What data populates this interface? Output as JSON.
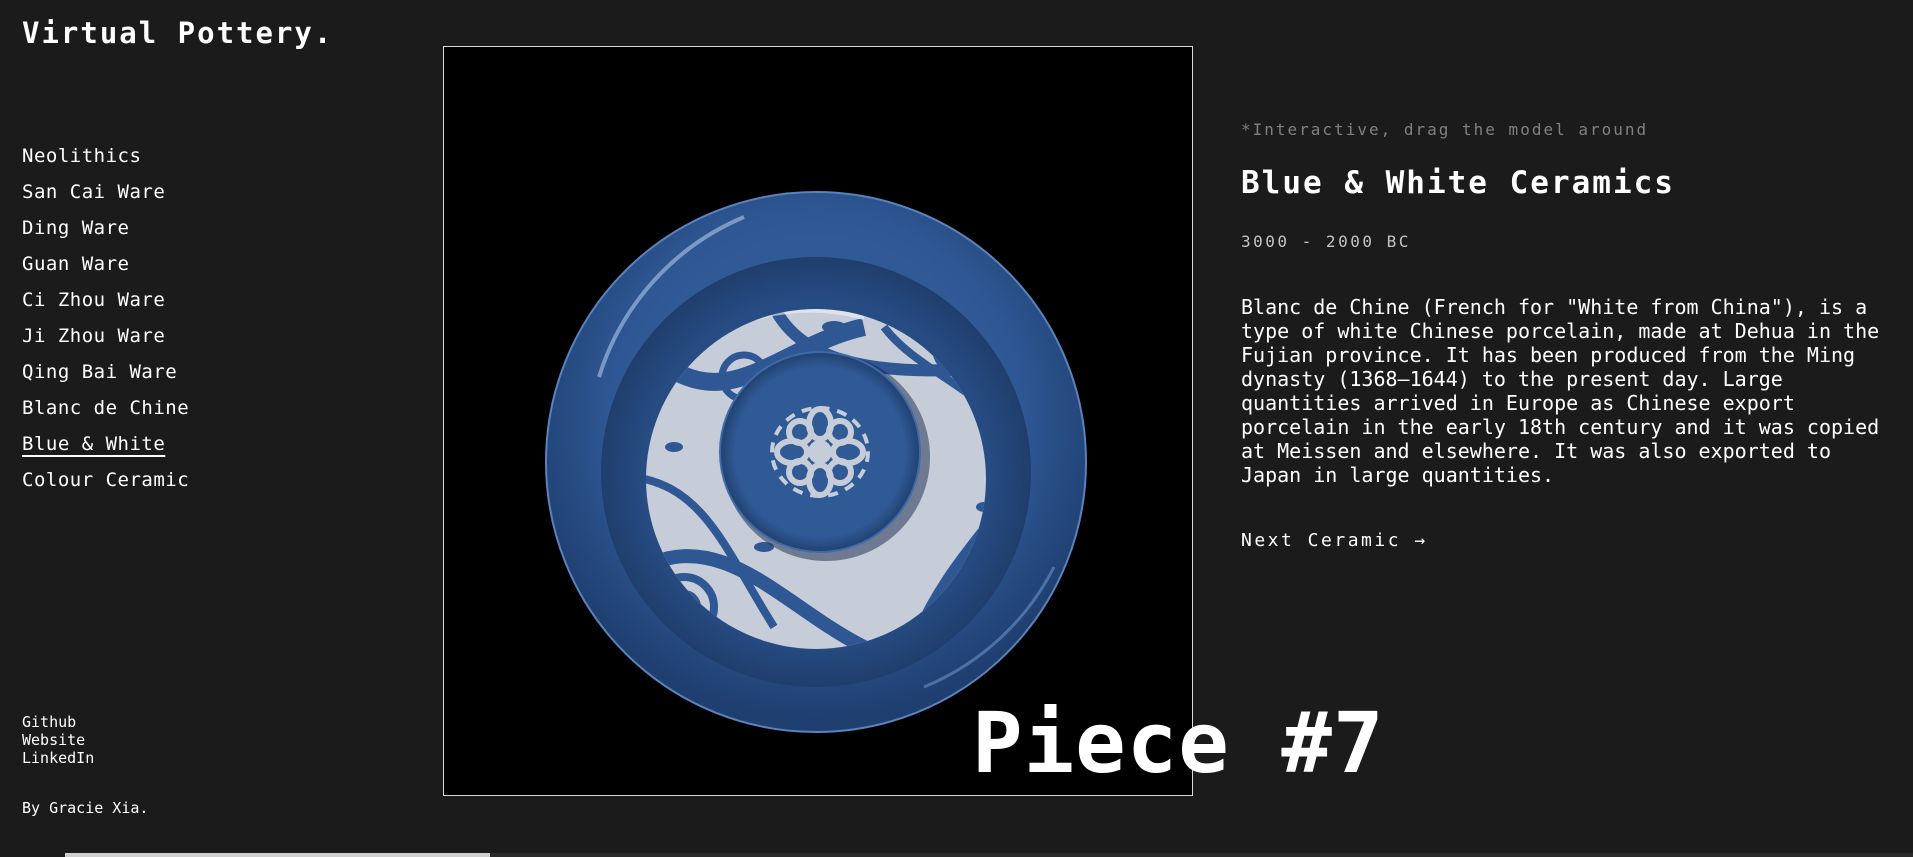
{
  "brand": "Virtual Pottery.",
  "nav": {
    "items": [
      {
        "label": "Neolithics"
      },
      {
        "label": "San Cai Ware"
      },
      {
        "label": "Ding Ware"
      },
      {
        "label": "Guan Ware"
      },
      {
        "label": "Ci Zhou Ware"
      },
      {
        "label": "Ji Zhou Ware"
      },
      {
        "label": "Qing Bai Ware"
      },
      {
        "label": "Blanc de Chine"
      },
      {
        "label": "Blue & White",
        "active": true
      },
      {
        "label": "Colour Ceramic"
      }
    ]
  },
  "links": {
    "github": "Github",
    "website": "Website",
    "linkedin": "LinkedIn"
  },
  "byline": "By Gracie Xia.",
  "info": {
    "hint": "*Interactive, drag the model around",
    "title": "Blue & White Ceramics",
    "dates": "3000 - 2000 BC",
    "description": "Blanc de Chine (French for \"White from China\"), is a type of white Chinese porcelain, made at Dehua in the Fujian province. It has been produced from the Ming dynasty (1368–1644) to the present day. Large quantities arrived in Europe as Chinese export porcelain in the early 18th century and it was copied at Meissen and elsewhere. It was also exported to Japan in large quantities.",
    "next_label": "Next Ceramic →"
  },
  "piece_label": "Piece #7",
  "progress": {
    "value": 0.23
  },
  "colors": {
    "background": "#1b1b1b",
    "viewer_background": "#000000",
    "glaze_blue": "#2e5793",
    "porcelain_white": "#c6ccd8",
    "hint_gray": "#808080"
  }
}
